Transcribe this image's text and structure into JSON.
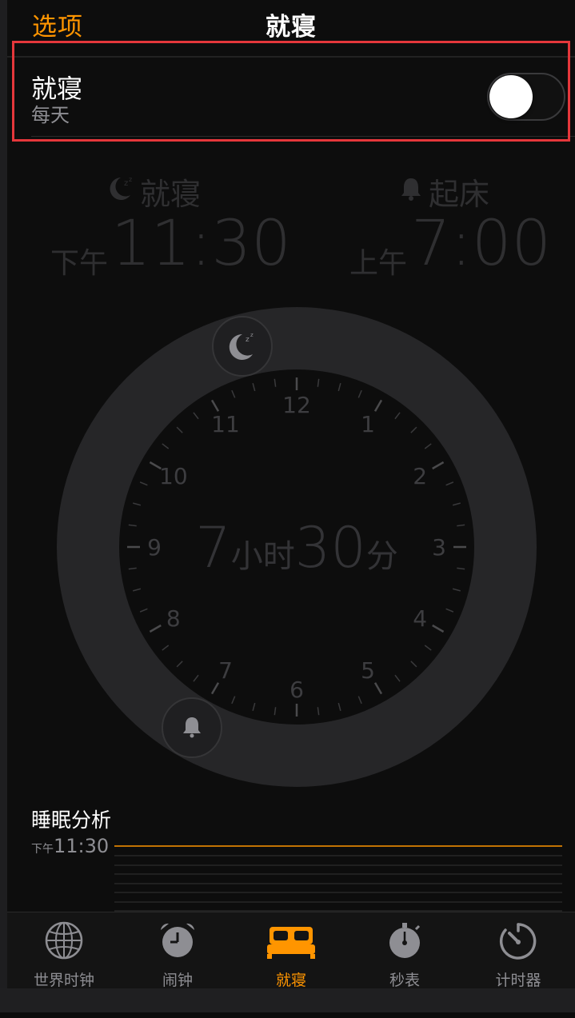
{
  "nav": {
    "left_label": "选项",
    "title": "就寝"
  },
  "bedtime_row": {
    "title": "就寝",
    "subtitle": "每天",
    "toggle_on": false
  },
  "schedule": {
    "bedtime": {
      "label": "就寝",
      "ampm": "下午",
      "time": "11:30"
    },
    "wake": {
      "label": "起床",
      "ampm": "上午",
      "time": "7:00"
    }
  },
  "clock": {
    "hour_numbers": [
      "12",
      "1",
      "2",
      "3",
      "4",
      "5",
      "6",
      "7",
      "8",
      "9",
      "10",
      "11"
    ],
    "duration": {
      "hours": "7",
      "hours_unit": "小时",
      "minutes": "30",
      "minutes_unit": "分"
    }
  },
  "analysis": {
    "title": "睡眠分析",
    "ampm": "下午",
    "time": "11:30"
  },
  "tabs": [
    {
      "label": "世界时钟",
      "icon": "globe-icon"
    },
    {
      "label": "闹钟",
      "icon": "alarm-clock-icon"
    },
    {
      "label": "就寝",
      "icon": "bed-icon"
    },
    {
      "label": "秒表",
      "icon": "stopwatch-icon"
    },
    {
      "label": "计时器",
      "icon": "timer-icon"
    }
  ],
  "colors": {
    "accent": "#ff9500",
    "highlight": "#e5373b",
    "background": "#0d0d0d"
  }
}
